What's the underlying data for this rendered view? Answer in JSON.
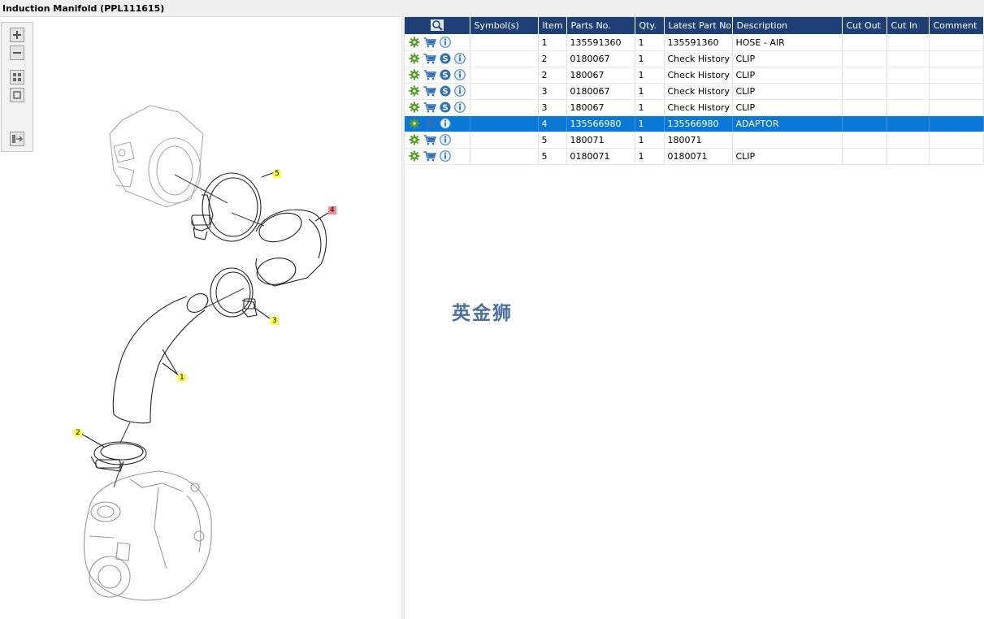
{
  "window": {
    "title": "Induction Manifold (PPL111615)"
  },
  "toolbar": {
    "buttons": [
      "zoom-in",
      "zoom-out",
      "fit-all",
      "actual-size",
      "export"
    ]
  },
  "diagram": {
    "callouts": [
      {
        "label": "5",
        "color": "yellow"
      },
      {
        "label": "4",
        "color": "pink"
      },
      {
        "label": "3",
        "color": "yellow"
      },
      {
        "label": "1",
        "color": "yellow"
      },
      {
        "label": "2",
        "color": "yellow"
      }
    ]
  },
  "table": {
    "columns": [
      "",
      "Symbol(s)",
      "Item",
      "Parts No.",
      "Qty.",
      "Latest Part No.",
      "Description",
      "Cut Out",
      "Cut In",
      "Comment"
    ],
    "rows": [
      {
        "icons": [
          "gear",
          "cart",
          "info"
        ],
        "symbols": "",
        "item": "1",
        "part_no": "135591360",
        "qty": "1",
        "latest": "135591360",
        "description": "HOSE - AIR",
        "cut_out": "",
        "cut_in": "",
        "comment": "",
        "selected": false
      },
      {
        "icons": [
          "gear",
          "cart",
          "s",
          "info"
        ],
        "symbols": "",
        "item": "2",
        "part_no": "0180067",
        "qty": "1",
        "latest": "Check History",
        "description": "CLIP",
        "cut_out": "",
        "cut_in": "",
        "comment": "",
        "selected": false
      },
      {
        "icons": [
          "gear",
          "cart",
          "s",
          "info"
        ],
        "symbols": "",
        "item": "2",
        "part_no": "180067",
        "qty": "1",
        "latest": "Check History",
        "description": "CLIP",
        "cut_out": "",
        "cut_in": "",
        "comment": "",
        "selected": false
      },
      {
        "icons": [
          "gear",
          "cart",
          "s",
          "info"
        ],
        "symbols": "",
        "item": "3",
        "part_no": "0180067",
        "qty": "1",
        "latest": "Check History",
        "description": "CLIP",
        "cut_out": "",
        "cut_in": "",
        "comment": "",
        "selected": false
      },
      {
        "icons": [
          "gear",
          "cart",
          "s",
          "info"
        ],
        "symbols": "",
        "item": "3",
        "part_no": "180067",
        "qty": "1",
        "latest": "Check History",
        "description": "CLIP",
        "cut_out": "",
        "cut_in": "",
        "comment": "",
        "selected": false
      },
      {
        "icons": [
          "gear",
          "cart",
          "info"
        ],
        "symbols": "",
        "item": "4",
        "part_no": "135566980",
        "qty": "1",
        "latest": "135566980",
        "description": "ADAPTOR",
        "cut_out": "",
        "cut_in": "",
        "comment": "",
        "selected": true
      },
      {
        "icons": [
          "gear",
          "cart",
          "info"
        ],
        "symbols": "",
        "item": "5",
        "part_no": "180071",
        "qty": "1",
        "latest": "180071",
        "description": "",
        "cut_out": "",
        "cut_in": "",
        "comment": "",
        "selected": false
      },
      {
        "icons": [
          "gear",
          "cart",
          "info"
        ],
        "symbols": "",
        "item": "5",
        "part_no": "0180071",
        "qty": "1",
        "latest": "0180071",
        "description": "CLIP",
        "cut_out": "",
        "cut_in": "",
        "comment": "",
        "selected": false
      }
    ]
  },
  "watermark": {
    "text": "英金狮"
  },
  "colors": {
    "header_bg": "#1d3f73",
    "selected_row": "#0a78d7",
    "callout_yellow": "#ffff40",
    "callout_pink": "#f08a96",
    "gear_green": "#5a9e2a",
    "cart_blue": "#2f6fb5",
    "info_blue": "#4b8ed0"
  }
}
